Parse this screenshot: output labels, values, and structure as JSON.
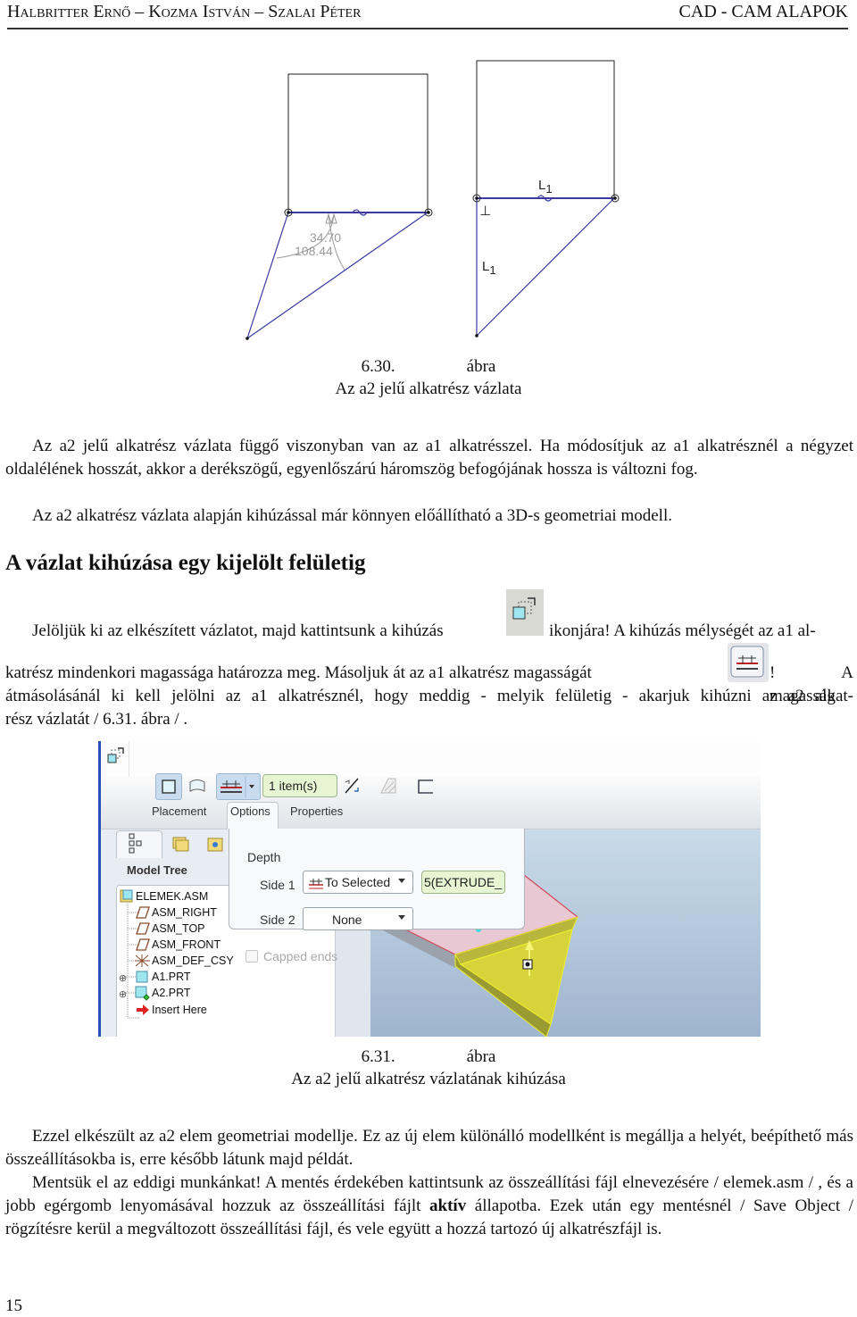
{
  "header": {
    "authors": [
      {
        "first": "H",
        "rest": "ALBRITTER",
        "first2": "E",
        "rest2": "RNŐ"
      },
      {
        "first": "K",
        "rest": "OZMA",
        "first2": "I",
        "rest2": "STVÁN"
      },
      {
        "first": "S",
        "rest": "ZALAI",
        "first2": "P",
        "rest2": "ÉTER"
      }
    ],
    "authors_text": "Halbritter Ernő – Kozma István – Szalai Péter",
    "book_title": "CAD - CAM ALAPOK"
  },
  "figure_630": {
    "left_sketch": {
      "angle_dim_1": "34.70",
      "angle_dim_2": "108.44"
    },
    "right_sketch": {
      "equal_length_label_top": "L",
      "equal_length_sub_top": "1",
      "equal_length_label_side": "L",
      "equal_length_sub_side": "1",
      "perpendicular_symbol": "⊥"
    },
    "caption_number": "6.30.",
    "caption_word": "ábra",
    "caption_title": "Az a2 jelű alkatrész vázlata"
  },
  "paragraphs": {
    "p1": "Az a2 jelű alkatrész vázlata függő viszonyban van az a1 alkatrésszel. Ha módosítjuk az a1 alkatrésznél a négyzet oldalélének hosszát, akkor a derékszögű, egyenlőszárú háromszög befogójának hossza is változni fog.",
    "p2": "Az a2 alkatrész vázlata alapján kihúzással már könnyen előállítható a 3D-s geometriai modell.",
    "section_title": "A vázlat kihúzása egy kijelölt felületig",
    "p3_line1_a": "Jelöljük ki az elkészített vázlatot, majd kattintsunk a kihúzás",
    "p3_line1_b": "ikonjára! A kihúzás mélységét az a1 al-",
    "p3_line2_a": "katrész mindenkori magassága határozza meg. Másoljuk át az a1 alkatrész magasságát",
    "p3_line2_b": "! A magasság",
    "p3_rest": "átmásolásánál ki kell jelölni az a1 alkatrésznél, hogy meddig - melyik felületig - akarjuk kihúzni az a2 alkatrész vázlatát / 6.31. ábra /.",
    "p3_line3": "átmásolásánál ki kell jelölni az a1 alkatrésznél, hogy meddig - melyik felületig - akarjuk kihúzni az a2 alkat-",
    "p3_line4": "rész vázlatát / 6.31. ábra / .",
    "p4": "Ezzel elkészült az a2 elem geometriai modellje. Ez az új elem különálló modellként is megállja a helyét, beépíthető más összeállításokba is, erre később látunk majd példát.",
    "p5_a": "Mentsük el az eddigi munkánkat! A mentés érdekében kattintsunk az összeállítási fájl elnevezésére / elemek.asm / , és a jobb egérgomb lenyomásával hozzuk az összeállítási fájlt ",
    "p5_bold": "aktív",
    "p5_b": " állapotba. Ezek után egy mentésnél / Save Object / rögzítésre kerül a megváltozott összeállítási fájl, és vele együtt a hozzá tartozó új alkatrészfájl is."
  },
  "inline_icons": {
    "extrude": "extrude-icon",
    "to_selected": "to-selected-depth-icon"
  },
  "figure_631": {
    "toolbar": {
      "solid_icon": "solid-icon",
      "surface_icon": "surface-icon",
      "depth_option_icon": "to-selected-icon",
      "reference_field": "1 item(s)",
      "flip_icon": "flip-direction-icon",
      "remove_material_icon": "remove-material-icon",
      "thicken_icon": "thicken-icon"
    },
    "tabs": [
      "Placement",
      "Options",
      "Properties"
    ],
    "active_tab": "Options",
    "options_panel": {
      "section": "Depth",
      "side1_label": "Side 1",
      "side1_value": "To Selected",
      "side1_reference": "5(EXTRUDE_",
      "side2_label": "Side 2",
      "side2_value": "None",
      "capped_ends_label": "Capped ends",
      "capped_ends_checked": false
    },
    "model_tree": {
      "title": "Model Tree",
      "items": [
        {
          "label": "ELEMEK.ASM",
          "icon": "assembly-icon",
          "expandable": false
        },
        {
          "label": "ASM_RIGHT",
          "icon": "datum-plane-icon",
          "expandable": false
        },
        {
          "label": "ASM_TOP",
          "icon": "datum-plane-icon",
          "expandable": false
        },
        {
          "label": "ASM_FRONT",
          "icon": "datum-plane-icon",
          "expandable": false
        },
        {
          "label": "ASM_DEF_CSY",
          "icon": "csys-icon",
          "expandable": false
        },
        {
          "label": "A1.PRT",
          "icon": "part-icon",
          "expandable": true
        },
        {
          "label": "A2.PRT",
          "icon": "active-part-icon",
          "expandable": true
        },
        {
          "label": "Insert Here",
          "icon": "insert-arrow-icon",
          "expandable": false
        }
      ]
    },
    "caption_number": "6.31.",
    "caption_word": "ábra",
    "caption_title": "Az a2 jelű alkatrész vázlatának kihúzása"
  },
  "footer": {
    "page_number": "15"
  },
  "colors": {
    "sketch_line": "#3a3aa0",
    "dim_text": "#9a9a9a",
    "viewport_top": "#c9dbe9",
    "viewport_bottom": "#9fb5cf",
    "extrude_yellow": "#d7d33a",
    "plate_pink": "#e8c8d2"
  }
}
